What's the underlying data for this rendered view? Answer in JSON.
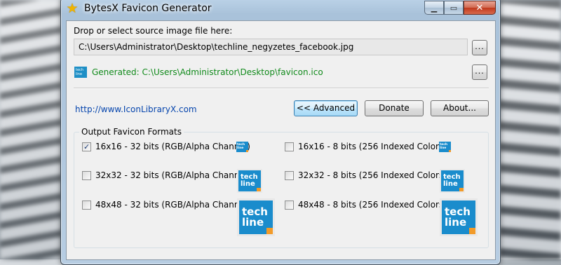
{
  "window": {
    "title": "BytesX Favicon Generator",
    "title_icon": "star-icon",
    "controls": {
      "minimize": "minimize-icon",
      "maximize": "maximize-icon",
      "close": "close-icon"
    }
  },
  "source": {
    "label": "Drop or select source image file here:",
    "path": "C:\\Users\\Administrator\\Desktop\\techline_negyzetes_facebook.jpg",
    "browse_label": "..."
  },
  "output": {
    "generated_text": "Generated: C:\\Users\\Administrator\\Desktop\\favicon.ico",
    "generated_color": "#118a1b",
    "browse_label": "..."
  },
  "link": {
    "text": "http://www.IconLibraryX.com",
    "color": "#0645ad"
  },
  "buttons": {
    "advanced": "<< Advanced",
    "donate": "Donate",
    "about": "About..."
  },
  "formats": {
    "title": "Output Favicon Formats",
    "items": [
      {
        "label": "16x16 - 32 bits (RGB/Alpha Channel)",
        "checked": true
      },
      {
        "label": "16x16 - 8 bits (256 Indexed Colors)",
        "checked": false
      },
      {
        "label": "32x32 - 32 bits (RGB/Alpha Channel)",
        "checked": false
      },
      {
        "label": "32x32 - 8 bits (256 Indexed Colors)",
        "checked": false
      },
      {
        "label": "48x48 - 32 bits (RGB/Alpha Channel)",
        "checked": false
      },
      {
        "label": "48x48 - 8 bits (256 Indexed Colors)",
        "checked": false
      }
    ],
    "preview_text": [
      "tech",
      "line"
    ],
    "preview_color": "#1a8ccc"
  }
}
